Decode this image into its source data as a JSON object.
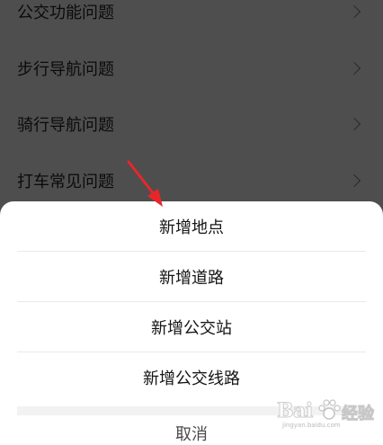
{
  "background_list": {
    "items": [
      {
        "label": "公交功能问题"
      },
      {
        "label": "步行导航问题"
      },
      {
        "label": "骑行导航问题"
      },
      {
        "label": "打车常见问题"
      }
    ]
  },
  "action_sheet": {
    "options": [
      {
        "label": "新增地点"
      },
      {
        "label": "新增道路"
      },
      {
        "label": "新增公交站"
      },
      {
        "label": "新增公交线路"
      }
    ],
    "cancel_label": "取消"
  },
  "annotation": {
    "arrow_color": "#e8262a"
  },
  "watermark": {
    "brand": "Bai",
    "brand_suffix": "经验",
    "site": "jingyan.baidu.com"
  },
  "colors": {
    "overlay_background": "#4e4e4e",
    "sheet_background": "#ffffff"
  }
}
